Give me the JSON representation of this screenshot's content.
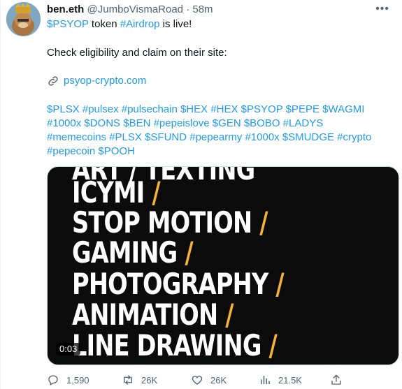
{
  "author": {
    "name": "ben.eth",
    "handle": "@JumboVismaRoad",
    "separator": "·",
    "time": "58m"
  },
  "text": {
    "line1_token": "$PSYOP",
    "line1_mid": " token ",
    "line1_tag": "#Airdrop",
    "line1_end": " is live!",
    "line2": "Check eligibility and claim on their site:",
    "url": "psyop-crypto.com",
    "hashtags": "$PLSX #pulsex #pulsechain $HEX #HEX $PSYOP $PEPE $WAGMI #1000x $DONS $BEN #pepeislove $GEN $BOBO #LADYS #memecoins #PLSX $SFUND #pepearmy #1000x $SMUDGE #crypto #pepecoin $POOH"
  },
  "media": {
    "lines": [
      {
        "text": "ART / TEXTING",
        "slash": ""
      },
      {
        "text": "ICYMI",
        "slash": "/"
      },
      {
        "text": "STOP MOTION",
        "slash": "/"
      },
      {
        "text": "GAMING",
        "slash": "/"
      },
      {
        "text": "PHOTOGRAPHY",
        "slash": "/"
      },
      {
        "text": "ANIMATION",
        "slash": "/"
      },
      {
        "text": "LINE DRAWING",
        "slash": "/"
      }
    ],
    "duration": "0:03"
  },
  "actions": {
    "replies": "1,590",
    "retweets": "26K",
    "likes": "26K",
    "views": "21.5K"
  },
  "colors": {
    "link": "#1d9bf0",
    "muted": "#536471",
    "accent_slash": "#f2b236"
  }
}
